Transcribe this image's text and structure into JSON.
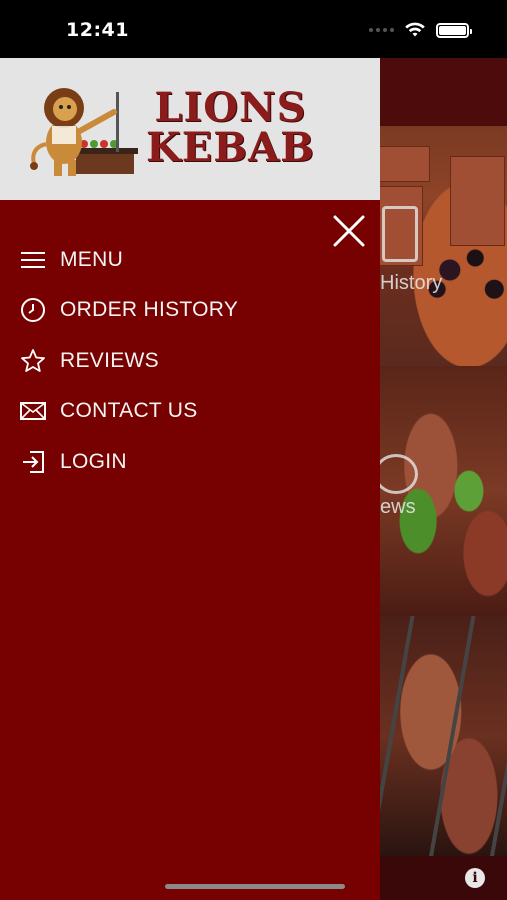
{
  "status_bar": {
    "time": "12:41",
    "wifi_icon": "wifi-icon",
    "battery_icon": "battery-icon"
  },
  "drawer": {
    "brand": {
      "line1": "LIONS",
      "line2": "KEBAB",
      "logo_icon": "lion-chef-icon",
      "color": "#8b1c1c"
    },
    "close_icon": "close-icon",
    "items": [
      {
        "label": "MENU",
        "icon": "hamburger-icon"
      },
      {
        "label": "ORDER HISTORY",
        "icon": "clock-icon"
      },
      {
        "label": "REVIEWS",
        "icon": "star-icon"
      },
      {
        "label": "CONTACT US",
        "icon": "envelope-icon"
      },
      {
        "label": "LOGIN",
        "icon": "login-icon"
      }
    ],
    "background_color": "#770000"
  },
  "background": {
    "tile_labels": [
      "History",
      "ews"
    ],
    "info_icon": "info-icon"
  }
}
